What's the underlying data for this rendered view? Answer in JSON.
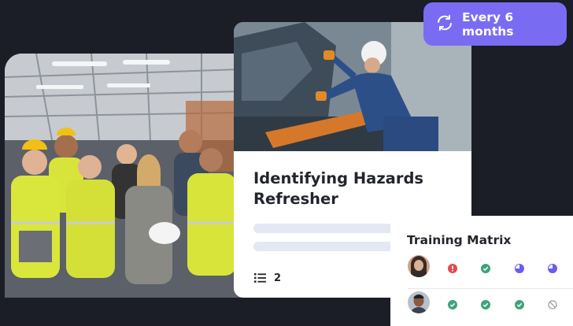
{
  "card": {
    "title": "Identifying Hazards Refresher",
    "module_count": "2"
  },
  "badge": {
    "label": "Every 6 months",
    "icon": "refresh-icon"
  },
  "matrix": {
    "title": "Training Matrix",
    "rows": [
      {
        "avatar": "woman-avatar",
        "statuses": [
          "overdue",
          "complete",
          "in-progress",
          "in-progress"
        ]
      },
      {
        "avatar": "man-avatar",
        "statuses": [
          "complete",
          "complete",
          "complete",
          "not-applicable"
        ]
      }
    ]
  },
  "colors": {
    "background": "#1b1d27",
    "accent": "#7a6cf2",
    "complete": "#3fa37a",
    "overdue": "#e5484d",
    "in_progress": "#6b5cf0",
    "not_applicable": "#9aa0aa"
  }
}
